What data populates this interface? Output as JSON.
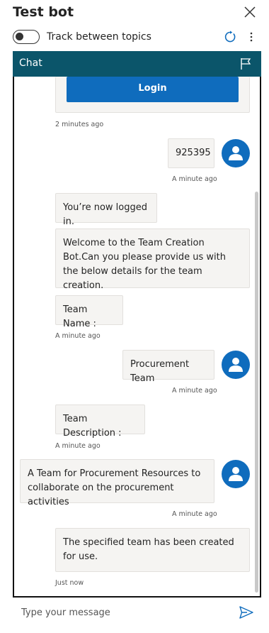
{
  "window": {
    "title": "Test bot"
  },
  "toggle": {
    "label": "Track between topics",
    "on": false
  },
  "icons": [
    "close-icon",
    "refresh-icon",
    "more-options-icon",
    "flag-icon",
    "user-icon",
    "send-icon"
  ],
  "chat": {
    "header": "Chat"
  },
  "login_card": {
    "button_label": "Login",
    "timestamp": "2 minutes ago"
  },
  "messages": [
    {
      "from": "user",
      "text": "925395",
      "timestamp": "A minute ago"
    },
    {
      "from": "bot",
      "text": "You’re now logged in."
    },
    {
      "from": "bot",
      "text": "Welcome to the Team Creation Bot.Can you please provide us with the below details for the team creation."
    },
    {
      "from": "bot",
      "text": "Team Name :",
      "timestamp": "A minute ago"
    },
    {
      "from": "user",
      "text": "Procurement Team",
      "timestamp": "A minute ago"
    },
    {
      "from": "bot",
      "text": "Team Description :",
      "timestamp": "A minute ago"
    },
    {
      "from": "user",
      "text": "A Team for Procurement Resources to collaborate on the procurement activities",
      "timestamp": "A minute ago"
    },
    {
      "from": "bot",
      "text": "The specified team has been created for use.",
      "timestamp": "Just now"
    }
  ],
  "composer": {
    "placeholder": "Type your message"
  },
  "colors": {
    "header": "#0b556a",
    "accent": "#0f6cbd",
    "bubble": "#f5f4f2"
  }
}
